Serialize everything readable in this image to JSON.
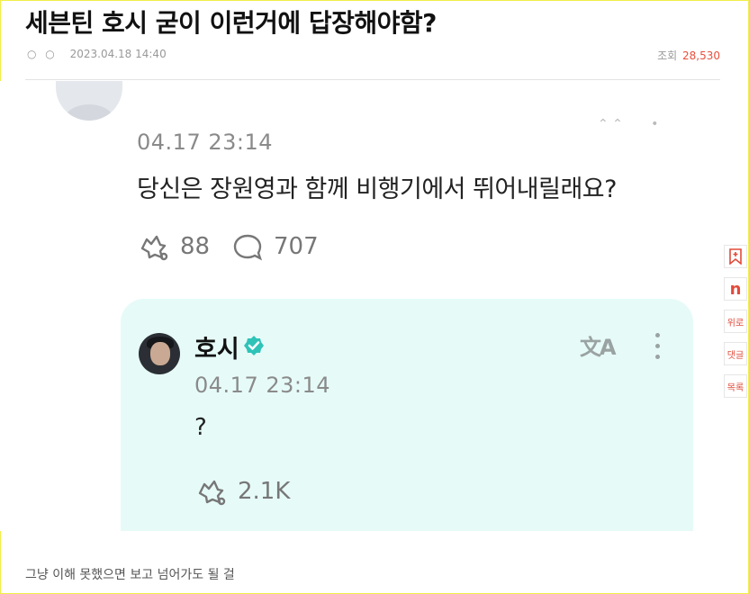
{
  "article": {
    "title": "세븐틴 호시 굳이 이런거에 답장해야함?",
    "dots": "○ ○",
    "date": "2023.04.18 14:40",
    "views_label": "조회",
    "views_count": "28,530"
  },
  "screenshot": {
    "post": {
      "time": "04.17 23:14",
      "text": "당신은 장원영과 함께 비행기에서 뛰어내릴래요?",
      "reposts": "88",
      "replies": "707"
    },
    "reply": {
      "name": "호시",
      "time": "04.17 23:14",
      "text": "?",
      "reposts": "2.1K",
      "translate_icon_text": "文A"
    }
  },
  "sidebar": {
    "buttons": [
      "위로",
      "댓글",
      "목록"
    ]
  },
  "comment": "그냥 이해 못했으면 보고 넘어가도 될 걸",
  "colors": {
    "reply_bg": "#e6fbf8",
    "accent": "#e84f3d",
    "verified": "#2fc3b8"
  }
}
